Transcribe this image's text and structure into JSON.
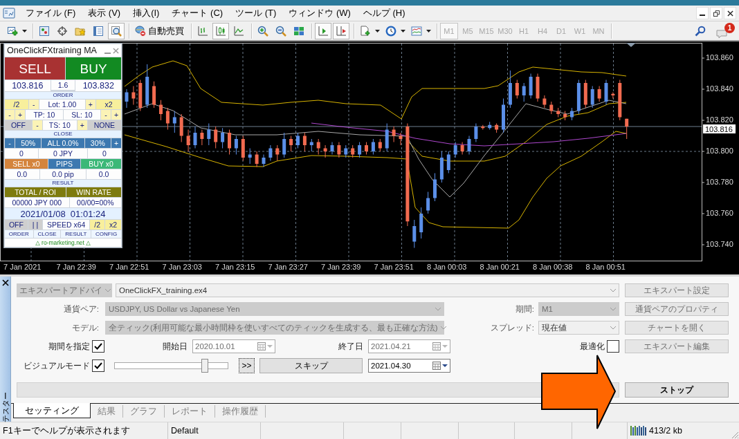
{
  "menu_bar": {
    "items": [
      "ファイル (F)",
      "表示 (V)",
      "挿入(I)",
      "チャート (C)",
      "ツール (T)",
      "ウィンドウ (W)",
      "ヘルプ (H)"
    ]
  },
  "toolbar": {
    "items": [
      {
        "kind": "new-chart",
        "pressed": false
      },
      {
        "kind": "dropdown"
      },
      {
        "kind": "separator"
      },
      {
        "kind": "profiles",
        "pressed": false
      },
      {
        "kind": "crosshair",
        "pressed": false
      },
      {
        "kind": "favorites",
        "pressed": false
      },
      {
        "kind": "navigator",
        "pressed": false
      },
      {
        "kind": "data-window",
        "pressed": true
      },
      {
        "kind": "separator"
      },
      {
        "kind": "autotrading",
        "label": "自動売買",
        "pressed": false
      },
      {
        "kind": "separator"
      },
      {
        "kind": "bar-chart",
        "pressed": false
      },
      {
        "kind": "candle-chart",
        "pressed": true
      },
      {
        "kind": "line-chart",
        "pressed": false
      },
      {
        "kind": "separator"
      },
      {
        "kind": "zoom-in",
        "pressed": false
      },
      {
        "kind": "zoom-out",
        "pressed": false
      },
      {
        "kind": "tile",
        "pressed": false
      },
      {
        "kind": "separator"
      },
      {
        "kind": "auto-scroll",
        "pressed": true
      },
      {
        "kind": "chart-shift",
        "pressed": true
      },
      {
        "kind": "separator"
      },
      {
        "kind": "indicators",
        "pressed": false
      },
      {
        "kind": "dropdown"
      },
      {
        "kind": "periods",
        "pressed": false
      },
      {
        "kind": "dropdown"
      },
      {
        "kind": "templates",
        "pressed": false
      },
      {
        "kind": "dropdown"
      },
      {
        "kind": "separator"
      }
    ],
    "timeframes": {
      "disabled": true,
      "items": [
        {
          "label": "M1",
          "selected": true
        },
        {
          "label": "M5",
          "selected": false
        },
        {
          "label": "M15",
          "selected": false
        },
        {
          "label": "M30",
          "selected": false
        },
        {
          "label": "H1",
          "selected": false
        },
        {
          "label": "H4",
          "selected": false
        },
        {
          "label": "D1",
          "selected": false
        },
        {
          "label": "W1",
          "selected": false
        },
        {
          "label": "MN",
          "selected": false
        }
      ]
    },
    "notifications": {
      "count": "1"
    }
  },
  "chart": {
    "price_labels": [
      "103.860",
      "103.840",
      "103.820",
      "103.800",
      "103.780",
      "103.760",
      "103.740"
    ],
    "current_price": "103.816",
    "time_labels": [
      "7 Jan 2021",
      "7 Jan 22:39",
      "7 Jan 22:51",
      "7 Jan 23:03",
      "7 Jan 23:15",
      "7 Jan 23:27",
      "7 Jan 23:39",
      "7 Jan 23:51",
      "8 Jan 00:03",
      "8 Jan 00:21",
      "8 Jan 00:38",
      "8 Jan 00:51"
    ]
  },
  "panel": {
    "title": "OneClickFXtraining MA",
    "rows": [
      [
        {
          "text": "SELL",
          "kind": "sell"
        },
        {
          "text": "BUY",
          "kind": "buy"
        }
      ],
      [
        {
          "text": "103.816",
          "kind": "price"
        },
        {
          "text": "1.6",
          "kind": "value"
        },
        {
          "text": "103.832",
          "kind": "price"
        }
      ],
      [
        {
          "text": "ORDER",
          "kind": "header"
        }
      ],
      [
        {
          "text": "/2",
          "kind": "yellow"
        },
        {
          "text": "-",
          "kind": "mini"
        },
        {
          "text": "Lot: 1.00",
          "kind": "value"
        },
        {
          "text": "+",
          "kind": "mini"
        },
        {
          "text": "x2",
          "kind": "yellow"
        }
      ],
      [
        {
          "text": "-",
          "kind": "mini"
        },
        {
          "text": "+",
          "kind": "mini"
        },
        {
          "text": "TP: 10",
          "kind": "value"
        },
        {
          "text": "SL: 10",
          "kind": "value"
        },
        {
          "text": "-",
          "kind": "mini"
        },
        {
          "text": "+",
          "kind": "mini"
        }
      ],
      [
        {
          "text": "OFF",
          "kind": "gray"
        },
        {
          "text": "-",
          "kind": "mini"
        },
        {
          "text": "TS: 10",
          "kind": "value"
        },
        {
          "text": "+",
          "kind": "mini"
        },
        {
          "text": "NONE",
          "kind": "gray"
        }
      ],
      [
        {
          "text": "CLOSE",
          "kind": "header"
        }
      ],
      [
        {
          "text": "-",
          "kind": "blue-mini"
        },
        {
          "text": "50%",
          "kind": "blue"
        },
        {
          "text": "ALL 0.0%",
          "kind": "blue"
        },
        {
          "text": "30%",
          "kind": "blue"
        },
        {
          "text": "+",
          "kind": "blue-mini"
        }
      ],
      [
        {
          "text": "0",
          "kind": "value"
        },
        {
          "text": "0 JPY",
          "kind": "value"
        },
        {
          "text": "0",
          "kind": "value"
        }
      ],
      [
        {
          "text": "SELL x0",
          "kind": "orange"
        },
        {
          "text": "PIPS",
          "kind": "blue"
        },
        {
          "text": "BUY x0",
          "kind": "green"
        }
      ],
      [
        {
          "text": "0.0",
          "kind": "value"
        },
        {
          "text": "0.0 pip",
          "kind": "value"
        },
        {
          "text": "0.0",
          "kind": "value"
        }
      ],
      [
        {
          "text": "RESULT",
          "kind": "header"
        }
      ],
      [
        {
          "text": "TOTAL / ROI",
          "kind": "olive"
        },
        {
          "text": "WIN RATE",
          "kind": "olive"
        }
      ],
      [
        {
          "text": "00000 JPY 000",
          "kind": "value"
        },
        {
          "text": "00/00=00%",
          "kind": "value"
        }
      ],
      [
        {
          "text": "2021/01/08  01:01:24",
          "kind": "clock"
        }
      ],
      [
        {
          "text": "OFF",
          "kind": "gray"
        },
        {
          "text": "| |",
          "kind": "gray"
        },
        {
          "text": "SPEED x64",
          "kind": "value"
        },
        {
          "text": "/2",
          "kind": "yellow"
        },
        {
          "text": "x2",
          "kind": "yellow"
        }
      ],
      [
        {
          "text": "ORDER",
          "kind": "tab"
        },
        {
          "text": "CLOSE",
          "kind": "tab"
        },
        {
          "text": "RESULT",
          "kind": "tab"
        },
        {
          "text": "CONFIG",
          "kind": "tab"
        }
      ],
      [
        {
          "text": "△ ro-marketing.net △",
          "kind": "footer"
        }
      ]
    ]
  },
  "tester": {
    "side_label": "テスター",
    "expert_type": {
      "value": "エキスパートアドバイ",
      "disabled": true
    },
    "expert_file": {
      "value": "OneClickFX_training.ex4",
      "disabled": false
    },
    "symbol": {
      "label": "通貨ペア:",
      "value": "USDJPY, US Dollar vs Japanese Yen",
      "disabled": true
    },
    "period": {
      "label": "期間:",
      "value": "M1",
      "disabled": true
    },
    "model": {
      "label": "モデル:",
      "value": "全ティック(利用可能な最小時間枠を使いすべてのティックを生成する、最も正確な方法)",
      "disabled": true
    },
    "spread": {
      "label": "スプレッド:",
      "value": "現在値",
      "disabled": false
    },
    "use_date": {
      "label": "期間を指定",
      "checked": true
    },
    "date_from": {
      "label": "開始日",
      "value": "2020.10.01",
      "disabled": true
    },
    "date_to": {
      "label": "終了日",
      "value": "2021.04.21",
      "disabled": true
    },
    "optimization": {
      "label": "最適化",
      "checked": false
    },
    "visual_mode": {
      "label": "ビジュアルモード",
      "checked": true
    },
    "speed": {
      "level": 0.81
    },
    "fast_forward": {
      "label": ">>"
    },
    "skip": {
      "label": "スキップ"
    },
    "skip_to": {
      "value": "2021.04.30",
      "disabled": false
    },
    "progress": {
      "level": 0
    },
    "side_buttons": [
      {
        "label": "エキスパート設定",
        "disabled": true
      },
      {
        "label": "通貨ペアのプロパティ",
        "disabled": true
      },
      {
        "label": "チャートを開く",
        "disabled": true
      },
      {
        "label": "エキスパート編集",
        "disabled": true
      }
    ],
    "stop": {
      "label": "ストップ"
    },
    "tabs": [
      {
        "label": "セッティング",
        "selected": true
      },
      {
        "label": "結果",
        "selected": false
      },
      {
        "label": "グラフ",
        "selected": false
      },
      {
        "label": "レポート",
        "selected": false
      },
      {
        "label": "操作履歴",
        "selected": false
      }
    ]
  },
  "status_bar": {
    "help": "F1キーでヘルプが表示されます",
    "profile": "Default",
    "traffic": "413/2 kb"
  }
}
